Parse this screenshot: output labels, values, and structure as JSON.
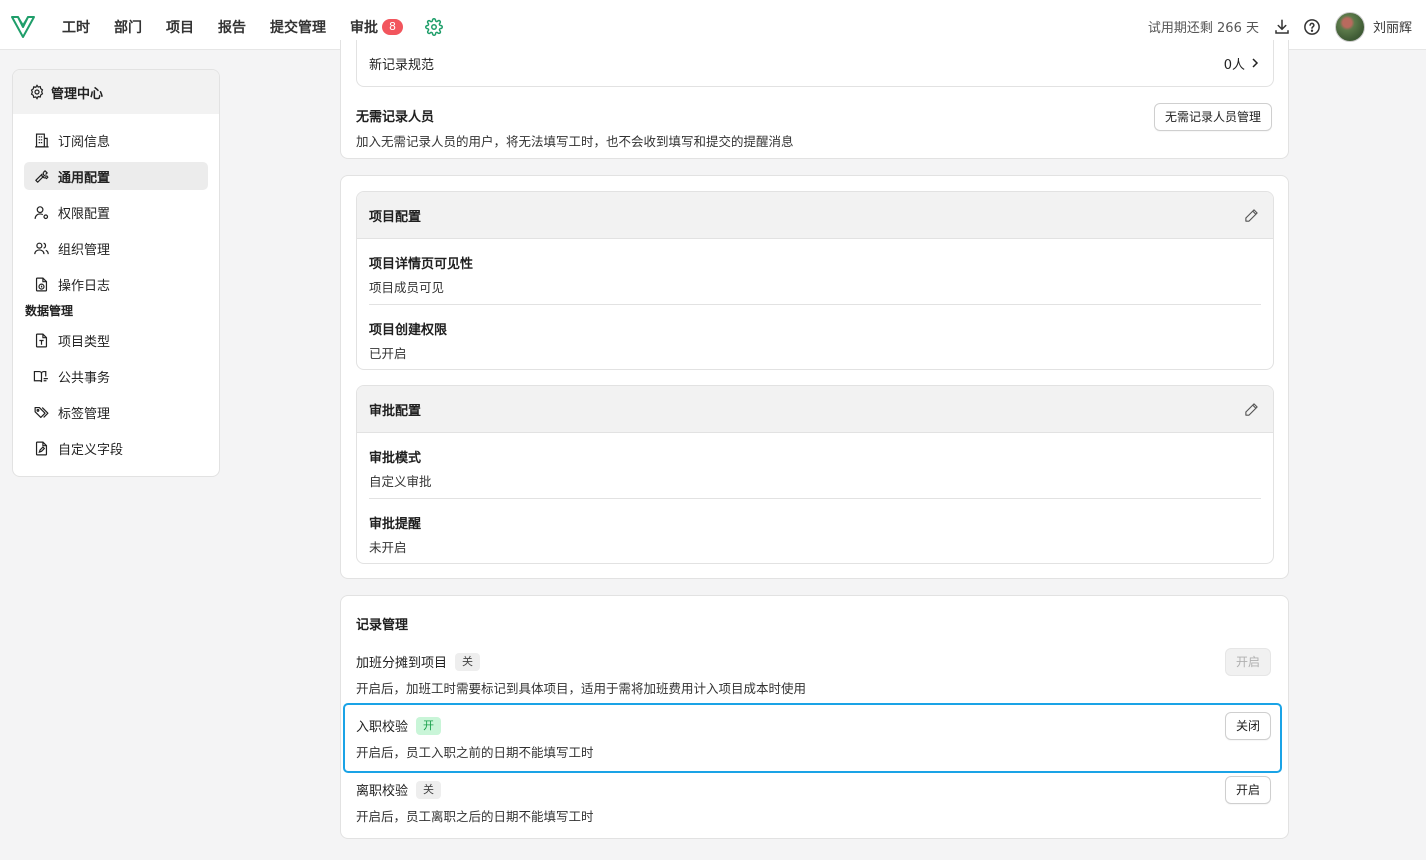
{
  "nav": {
    "items": [
      {
        "label": "工时"
      },
      {
        "label": "部门"
      },
      {
        "label": "项目"
      },
      {
        "label": "报告"
      },
      {
        "label": "提交管理"
      },
      {
        "label": "审批",
        "badge": "8"
      }
    ]
  },
  "header": {
    "trial_text": "试用期还剩 266 天",
    "username": "刘丽辉"
  },
  "sidebar": {
    "title": "管理中心",
    "items": [
      {
        "label": "订阅信息",
        "icon": "building-icon"
      },
      {
        "label": "通用配置",
        "icon": "wrench-icon",
        "active": true
      },
      {
        "label": "权限配置",
        "icon": "user-gear-icon"
      },
      {
        "label": "组织管理",
        "icon": "users-icon"
      },
      {
        "label": "操作日志",
        "icon": "file-clock-icon"
      }
    ],
    "section_label": "数据管理",
    "data_items": [
      {
        "label": "项目类型",
        "icon": "file-type-icon"
      },
      {
        "label": "公共事务",
        "icon": "book-open-icon"
      },
      {
        "label": "标签管理",
        "icon": "tags-icon"
      },
      {
        "label": "自定义字段",
        "icon": "file-edit-icon"
      }
    ]
  },
  "top_card": {
    "rule_label": "新记录规范",
    "rule_count": "0人",
    "exempt_title": "无需记录人员",
    "exempt_desc": "加入无需记录人员的用户，将无法填写工时，也不会收到填写和提交的提醒消息",
    "exempt_button": "无需记录人员管理"
  },
  "project_config": {
    "title": "项目配置",
    "items": [
      {
        "title": "项目详情页可见性",
        "value": "项目成员可见"
      },
      {
        "title": "项目创建权限",
        "value": "已开启"
      }
    ]
  },
  "approval_config": {
    "title": "审批配置",
    "items": [
      {
        "title": "审批模式",
        "value": "自定义审批"
      },
      {
        "title": "审批提醒",
        "value": "未开启"
      }
    ]
  },
  "record_management": {
    "title": "记录管理",
    "rows": [
      {
        "title": "加班分摊到项目",
        "status": "关",
        "desc": "开启后，加班工时需要标记到具体项目，适用于需将加班费用计入项目成本时使用",
        "button": "开启",
        "button_disabled": true
      },
      {
        "title": "入职校验",
        "status": "开",
        "desc": "开启后，员工入职之前的日期不能填写工时",
        "button": "关闭",
        "button_disabled": false
      },
      {
        "title": "离职校验",
        "status": "关",
        "desc": "开启后，员工离职之后的日期不能填写工时",
        "button": "开启",
        "button_disabled": false
      }
    ]
  },
  "colors": {
    "brand": "#1f9e6a",
    "badge": "#f2555d",
    "highlight": "#1aa3e6",
    "tag_on": "#c9f5d8"
  }
}
